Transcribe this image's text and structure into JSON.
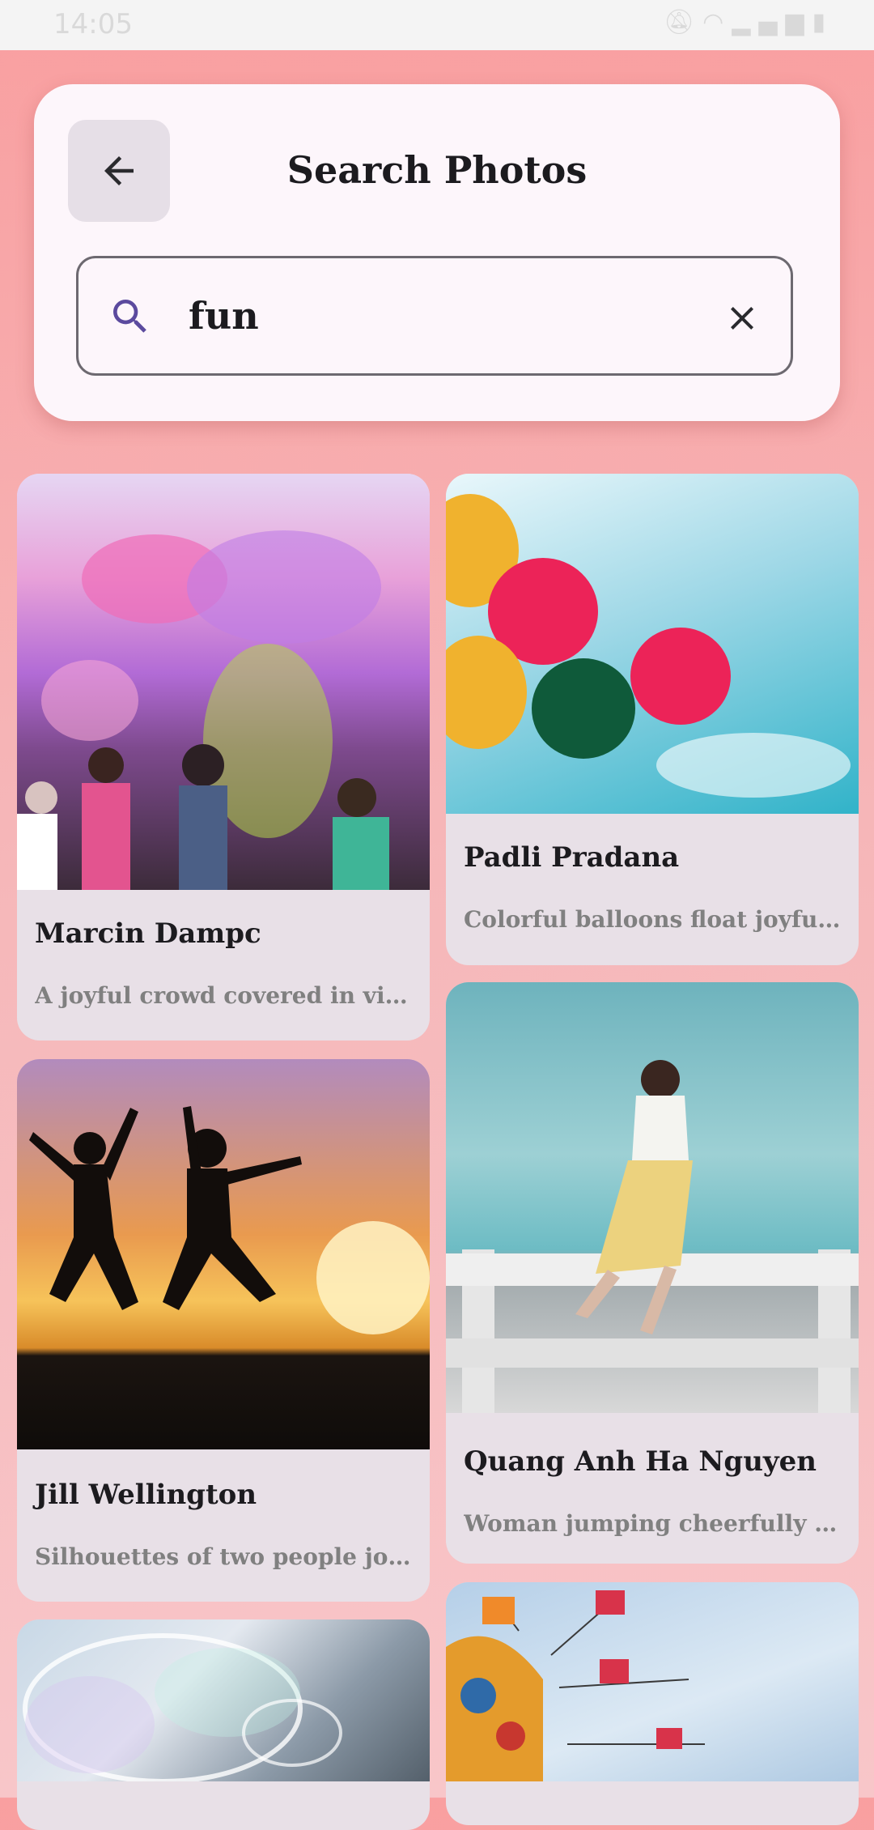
{
  "status_bar": {
    "time": "14:05",
    "icons": [
      "mute-icon",
      "wifi-icon",
      "signal-icon",
      "battery-icon"
    ]
  },
  "header": {
    "back_icon": "arrow-left-icon",
    "title": "Search Photos"
  },
  "search": {
    "value": "fun",
    "search_icon": "search-icon",
    "clear_icon": "close-icon",
    "accent_color": "#5b4a9e"
  },
  "results": [
    {
      "author": "Marcin Dampc",
      "description": "A joyful crowd covered in vivid col..."
    },
    {
      "author": "Padli Pradana",
      "description": "Colorful balloons float joyfully aga..."
    },
    {
      "author": "Jill Wellington",
      "description": "Silhouettes of two people joyfully j..."
    },
    {
      "author": "Quang Anh Ha Nguyen",
      "description": "Woman jumping cheerfully on a b..."
    },
    {
      "author": "",
      "description": ""
    },
    {
      "author": "",
      "description": ""
    }
  ],
  "colors": {
    "background_top": "#f99fa0",
    "card_surface": "#e8e0e7",
    "search_card": "#fdf6fb"
  }
}
